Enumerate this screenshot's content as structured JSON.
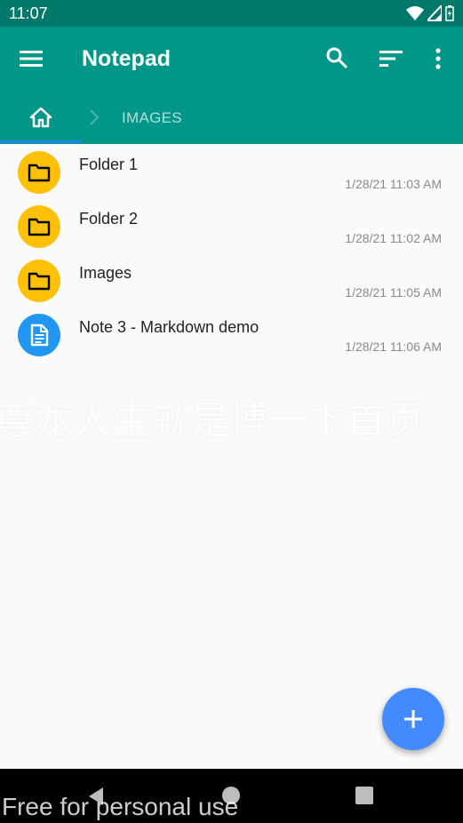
{
  "status_bar": {
    "time": "11:07",
    "icons": [
      "wifi-icon",
      "signal-icon",
      "battery-icon"
    ]
  },
  "app_bar": {
    "title": "Notepad",
    "icons": [
      "menu-icon",
      "search-icon",
      "sort-icon",
      "more-vert-icon"
    ]
  },
  "path_bar": {
    "home_icon": "home-icon",
    "crumb": "IMAGES"
  },
  "items": [
    {
      "name": "Folder 1",
      "date": "1/28/21 11:03 AM",
      "type": "folder"
    },
    {
      "name": "Folder 2",
      "date": "1/28/21 11:02 AM",
      "type": "folder"
    },
    {
      "name": "Images",
      "date": "1/28/21 11:05 AM",
      "type": "folder"
    },
    {
      "name": "Note 3 - Markdown demo",
      "date": "1/28/21 11:06 AM",
      "type": "note"
    }
  ],
  "watermark": "尊龙人生就是博一下首页",
  "footer_watermark": "Free for personal use",
  "colors": {
    "status_bar": "#00796B",
    "app_bar": "#009688",
    "folder": "#FFC107",
    "note": "#2196F3",
    "fab": "#448AFF",
    "tab_indicator": "#1E88E5"
  },
  "fab": {
    "icon": "add-icon"
  },
  "nav_bar": {
    "icons": [
      "back-icon",
      "home-button-icon",
      "recent-apps-icon"
    ]
  }
}
